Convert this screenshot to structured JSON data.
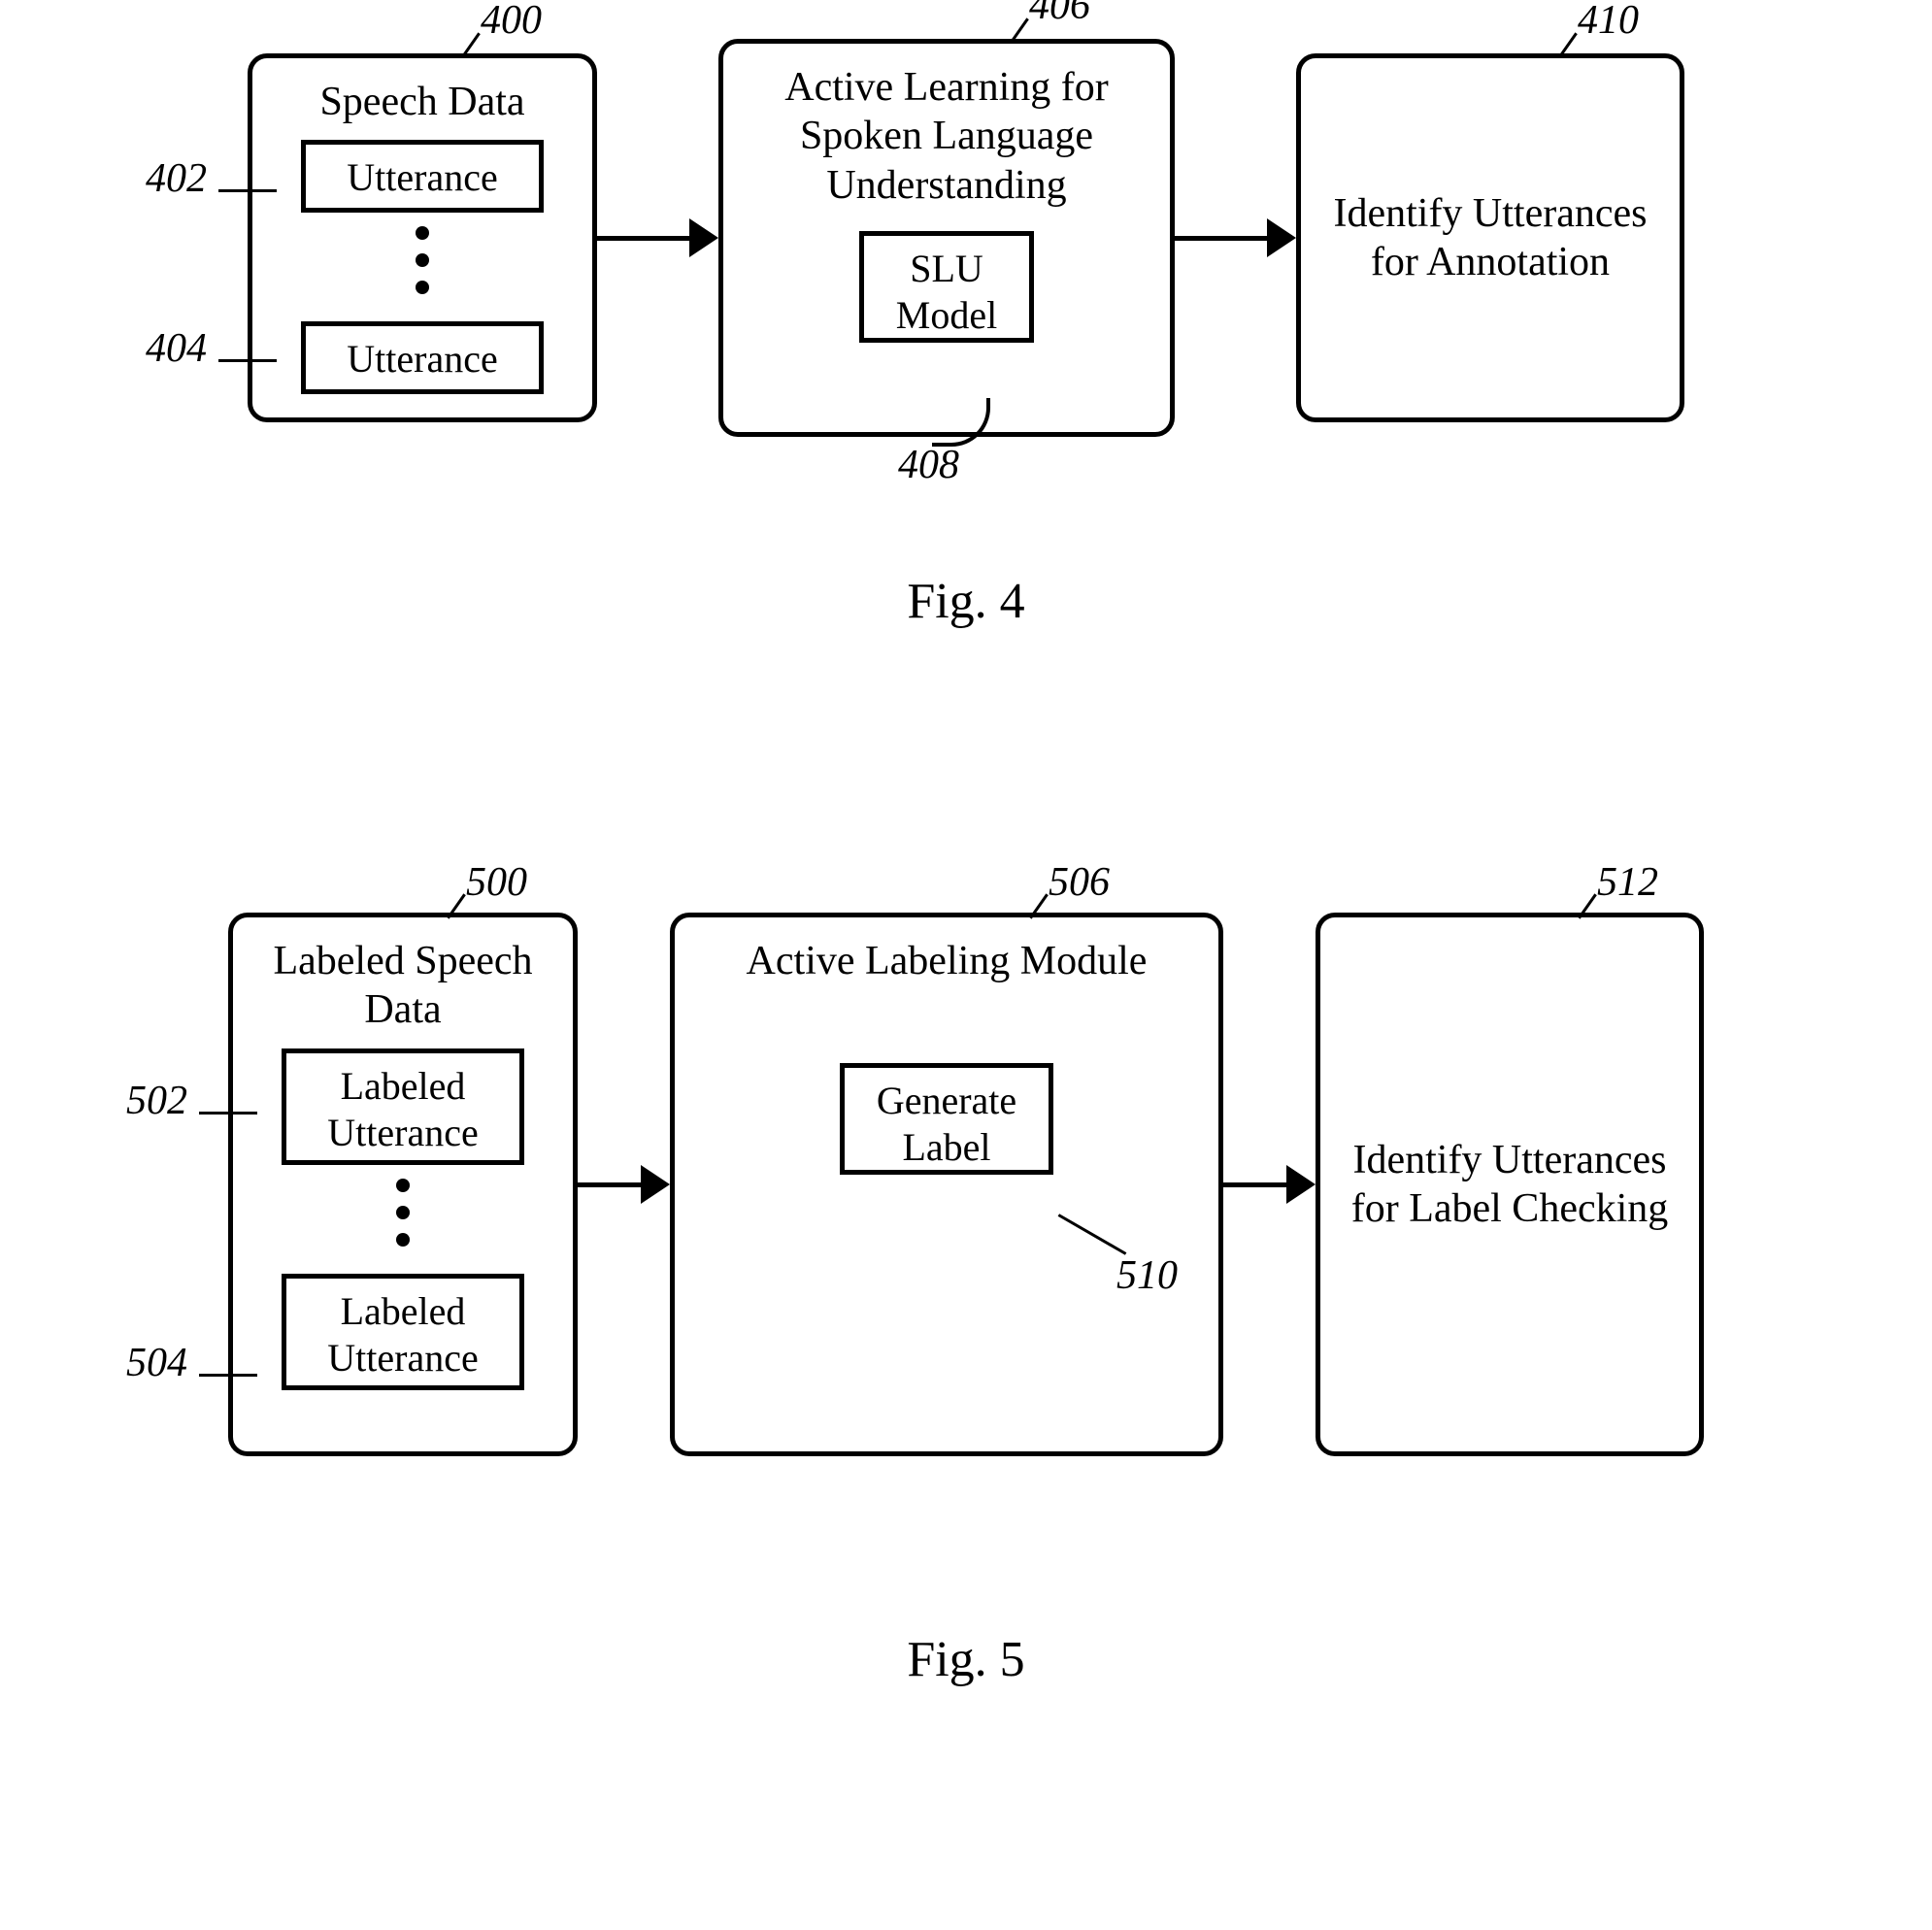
{
  "fig4": {
    "box1": {
      "title": "Speech Data",
      "ref": "400",
      "item1": {
        "label": "Utterance",
        "ref": "402"
      },
      "item2": {
        "label": "Utterance",
        "ref": "404"
      }
    },
    "box2": {
      "title": "Active Learning for Spoken Language Understanding",
      "ref": "406",
      "inner": {
        "label": "SLU\nModel",
        "ref": "408"
      }
    },
    "box3": {
      "title": "Identify Utterances for Annotation",
      "ref": "410"
    },
    "caption": "Fig.  4"
  },
  "fig5": {
    "box1": {
      "title": "Labeled Speech Data",
      "ref": "500",
      "item1": {
        "label": "Labeled\nUtterance",
        "ref": "502"
      },
      "item2": {
        "label": "Labeled\nUtterance",
        "ref": "504"
      }
    },
    "box2": {
      "title": "Active Labeling Module",
      "ref": "506",
      "inner": {
        "label": "Generate\nLabel",
        "ref": "510"
      }
    },
    "box3": {
      "title": "Identify Utterances for Label Checking",
      "ref": "512"
    },
    "caption": "Fig.  5"
  }
}
